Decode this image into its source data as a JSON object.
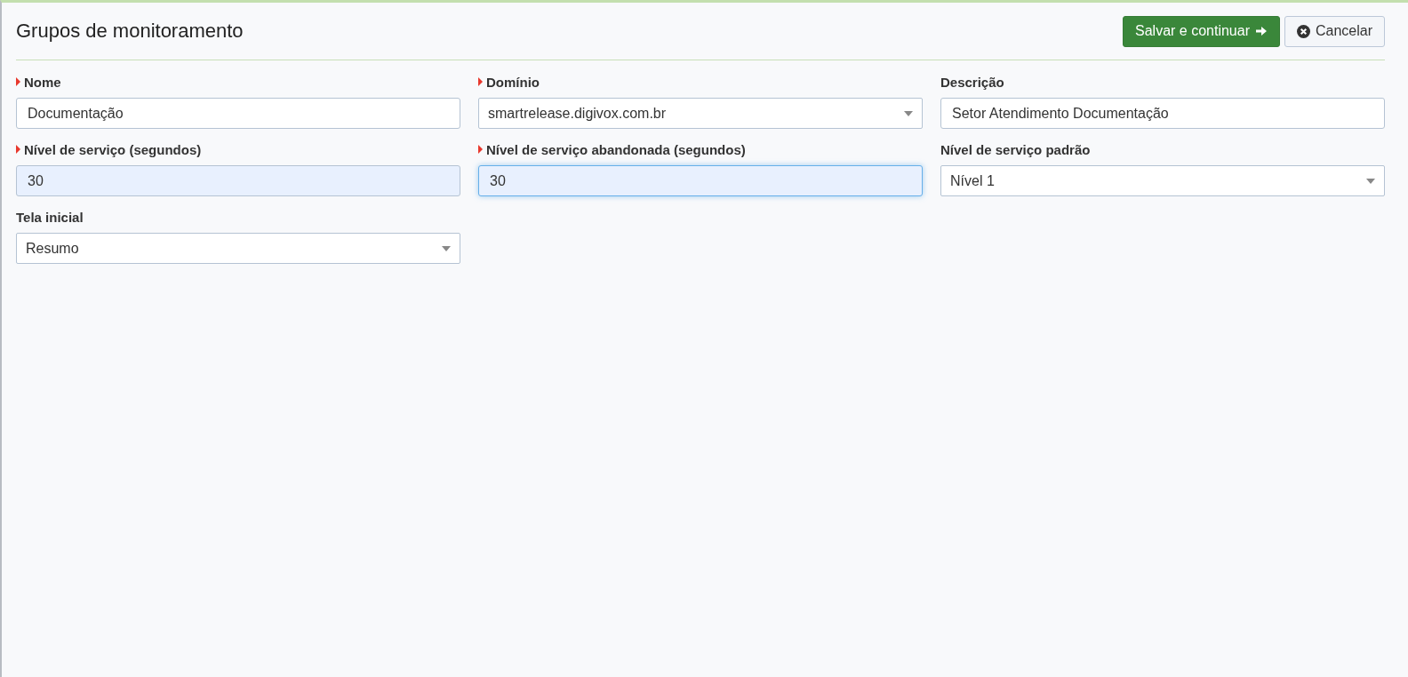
{
  "header": {
    "title": "Grupos de monitoramento",
    "buttons": [
      {
        "kind": "primary",
        "label": "Salvar e continuar"
      },
      {
        "kind": "cancel",
        "label": "Cancelar"
      }
    ]
  },
  "fields": [
    {
      "kind": "text",
      "label": "Nome",
      "required": true,
      "value": "Documentação",
      "autofilled": false,
      "focused": false
    },
    {
      "kind": "select",
      "label": "Domínio",
      "required": true,
      "value": "smartrelease.digivox.com.br",
      "autofilled": false,
      "focused": false
    },
    {
      "kind": "text",
      "label": "Descrição",
      "required": false,
      "value": "Setor Atendimento Documentação",
      "autofilled": false,
      "focused": false
    },
    {
      "kind": "text",
      "label": "Nível de serviço (segundos)",
      "required": true,
      "value": "30",
      "autofilled": true,
      "focused": false
    },
    {
      "kind": "text",
      "label": "Nível de serviço abandonada (segundos)",
      "required": true,
      "value": "30",
      "autofilled": true,
      "focused": true
    },
    {
      "kind": "select",
      "label": "Nível de serviço padrão",
      "required": false,
      "value": "Nível 1",
      "autofilled": false,
      "focused": false
    },
    {
      "kind": "select",
      "label": "Tela inicial",
      "required": false,
      "value": "Resumo",
      "autofilled": false,
      "focused": false
    }
  ]
}
